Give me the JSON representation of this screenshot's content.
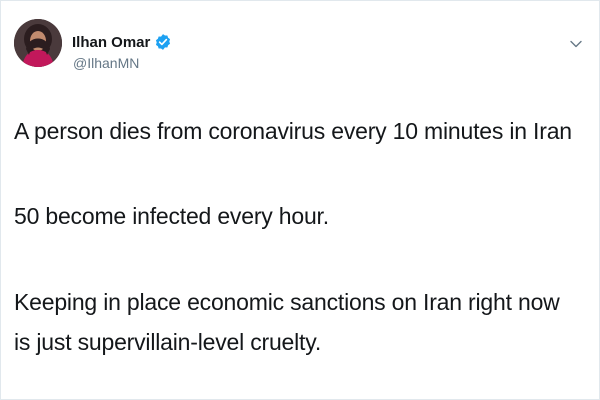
{
  "author": {
    "display_name": "Ilhan Omar",
    "handle": "@IlhanMN",
    "verified": true,
    "verified_color": "#1da1f2"
  },
  "menu": {
    "icon": "chevron-down-icon"
  },
  "tweet": {
    "paragraph_1": "A person dies from coronavirus every 10 minutes in Iran",
    "paragraph_2": "50 become infected every hour.",
    "paragraph_3_line_1": "Keeping in place economic sanctions on Iran right now",
    "paragraph_3_line_2": "is just supervillain-level cruelty."
  },
  "colors": {
    "text": "#14171a",
    "secondary": "#657786",
    "border": "#e1e8ed",
    "avatar_accent": "#c2185b"
  }
}
